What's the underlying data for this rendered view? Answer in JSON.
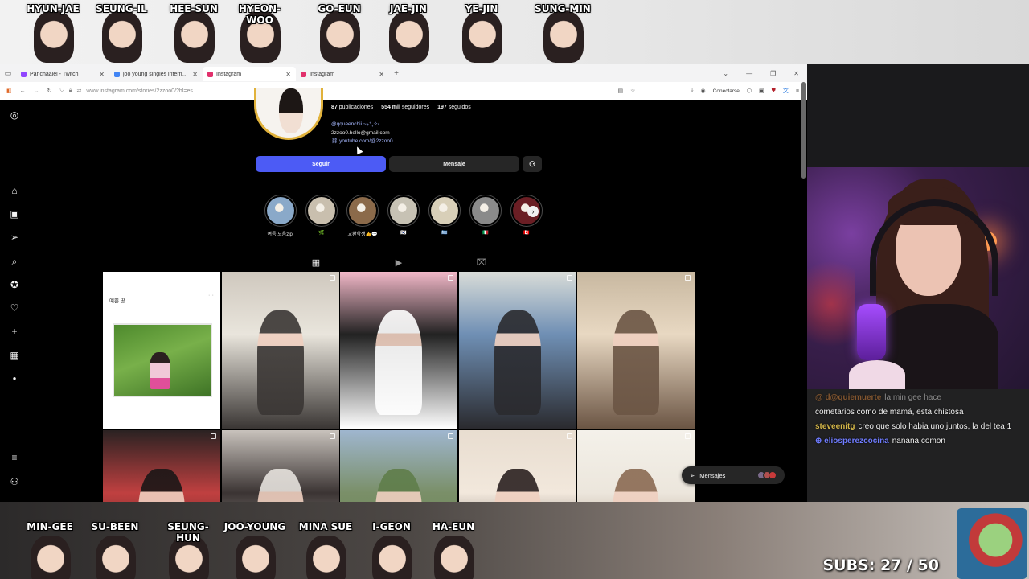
{
  "overlay": {
    "top_cast": [
      "HYUN-JAE",
      "SEUNG-IL",
      "HEE-SUN",
      "HYEON-WOO",
      "GO-EUN",
      "JAE-JIN",
      "YE-JIN",
      "SUNG-MIN"
    ],
    "bottom_cast": [
      "MIN-GEE",
      "SU-BEEN",
      "SEUNG-HUN",
      "JOO-YOUNG",
      "MINA SUE",
      "I-GEON",
      "HA-EUN"
    ],
    "subs_label": "SUBS: 27 / 50"
  },
  "browser": {
    "tabs": [
      {
        "label": "Panchaalel - Twitch",
        "icon_color": "#9146ff",
        "active": false
      },
      {
        "label": "joo young singles inferno insta",
        "icon_color": "#4285f4",
        "active": false
      },
      {
        "label": "Instagram",
        "icon_color": "#e1306c",
        "active": true
      },
      {
        "label": "Instagram",
        "icon_color": "#e1306c",
        "active": false
      }
    ],
    "url": "www.instagram.com/stories/2zzoo0/?hl=es",
    "connect_label": "Conectarse"
  },
  "profile": {
    "posts_count": "87",
    "posts_label": "publicaciones",
    "followers_count": "554 mil",
    "followers_label": "seguidores",
    "following_count": "197",
    "following_label": "seguidos",
    "handle_line": "@qqueenchii ~⁎⁺˳✧༚",
    "email": "2zzoo0.hello@gmail.com",
    "link": "youtube.com/@2zzoo0",
    "follow_label": "Seguir",
    "message_label": "Mensaje"
  },
  "highlights": [
    {
      "label": "여름 모음zip.",
      "color": "#8aa9c9"
    },
    {
      "label": "🌿",
      "color": "#c9bfae"
    },
    {
      "label": "교환학생👍💬",
      "color": "#8b6a4a"
    },
    {
      "label": "🇰🇷",
      "color": "#c7c2b4"
    },
    {
      "label": "🇬🇷",
      "color": "#d8cfb8"
    },
    {
      "label": "🇮🇹",
      "color": "#8a8a8a"
    },
    {
      "label": "🇨🇦",
      "color": "#6a1e24"
    }
  ],
  "grid": {
    "note_post_title": "예쁜 땅",
    "posts": [
      {
        "type": "note"
      },
      {
        "colors": [
          "#cfc8be",
          "#3a3634",
          "#e9e5dc"
        ]
      },
      {
        "colors": [
          "#f2b8c8",
          "#ffffff",
          "#222222"
        ]
      },
      {
        "colors": [
          "#d9dcd8",
          "#2a2a2e",
          "#6f8fb4"
        ]
      },
      {
        "colors": [
          "#c8b8a0",
          "#6b5544",
          "#e8d8c2"
        ]
      },
      {
        "colors": [
          "#2a2222",
          "#1a1616",
          "#c04040"
        ]
      },
      {
        "colors": [
          "#c8c2bc",
          "#e6e2dd",
          "#3b3433"
        ]
      },
      {
        "colors": [
          "#9fb6cf",
          "#5f7d4a",
          "#7a8f68"
        ]
      },
      {
        "colors": [
          "#e8ddd0",
          "#2a2020",
          "#f2e8dc"
        ]
      },
      {
        "colors": [
          "#f4f1ea",
          "#8a6a52",
          "#ece6dc"
        ]
      }
    ]
  },
  "messages_pill": {
    "label": "Mensajes"
  },
  "chat": {
    "messages": [
      {
        "user": "@ d@quiemuerte",
        "user_color": "#e58b3d",
        "text": "la min gee hace",
        "faded": true
      },
      {
        "user": "",
        "user_color": "#ffffff",
        "text": "cometarios como de mamá, esta chistosa",
        "faded": false
      },
      {
        "user": "steveenitg",
        "user_color": "#d6b84a",
        "text": "creo que solo habia uno juntos, la del tea 1",
        "faded": false
      },
      {
        "user": "⊕ eliosperezcocina",
        "user_color": "#6f7cff",
        "text": "nanana comon",
        "faded": false
      }
    ]
  }
}
